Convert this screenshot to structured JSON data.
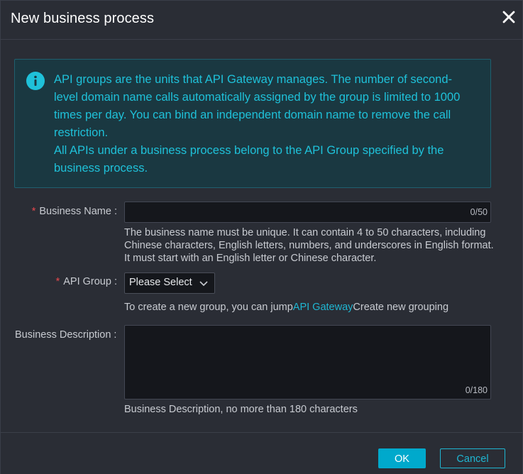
{
  "dialog": {
    "title": "New business process",
    "close_icon": "close-icon"
  },
  "alert": {
    "icon": "info-icon",
    "line1": "API groups are the units that API Gateway manages. The number of second-level domain name calls automatically assigned by the group is limited to 1000 times per day. You can bind an independent domain name to remove the call restriction.",
    "line2": "All APIs under a business process belong to the API Group specified by the business process."
  },
  "form": {
    "required_mark": "*",
    "business_name": {
      "label": "Business Name :",
      "value": "",
      "counter": "0/50",
      "help": "The business name must be unique. It can contain 4 to 50 characters, including Chinese characters, English letters, numbers, and underscores in English format. It must start with an English letter or Chinese character."
    },
    "api_group": {
      "label": "API Group :",
      "selected": "Please Select",
      "help_prefix": "To create a new group, you can jump",
      "help_link": "API Gateway",
      "help_suffix": "Create new grouping"
    },
    "business_description": {
      "label": "Business Description :",
      "value": "",
      "counter": "0/180",
      "help": "Business Description, no more than 180 characters"
    }
  },
  "footer": {
    "ok_label": "OK",
    "cancel_label": "Cancel"
  },
  "colors": {
    "accent": "#00a9cc",
    "alert_text": "#1fc1d9",
    "required": "#e5484d",
    "background": "#2a2d35"
  }
}
